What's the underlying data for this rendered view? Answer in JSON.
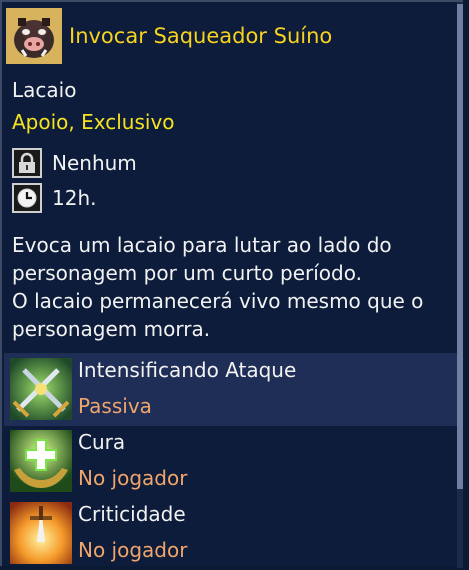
{
  "skill": {
    "title": "Invocar Saqueador Suíno",
    "portrait_icon": "boar-raider-icon"
  },
  "category": "Lacaio",
  "tags": "Apoio, Exclusivo",
  "requirement": {
    "icon": "lock-icon",
    "value": "Nenhum"
  },
  "cooldown": {
    "icon": "clock-icon",
    "value": "12h."
  },
  "description": [
    "Evoca um lacaio para lutar ao lado do",
    "personagem por um curto período.",
    "O lacaio permanecerá vivo mesmo que o",
    "personagem morra."
  ],
  "effects": [
    {
      "icon": "crossed-swords-icon",
      "name": "Intensificando Ataque",
      "type": "Passiva",
      "selected": true
    },
    {
      "icon": "healing-hands-icon",
      "name": "Cura",
      "type": "No jogador",
      "selected": false
    },
    {
      "icon": "critical-sword-icon",
      "name": "Criticidade",
      "type": "No jogador",
      "selected": false
    }
  ],
  "colors": {
    "background": "#0c1c3a",
    "title": "#f7d21e",
    "tags": "#f7e221",
    "effect_type": "#f0a56c",
    "selected_row": "#1f2e56"
  }
}
